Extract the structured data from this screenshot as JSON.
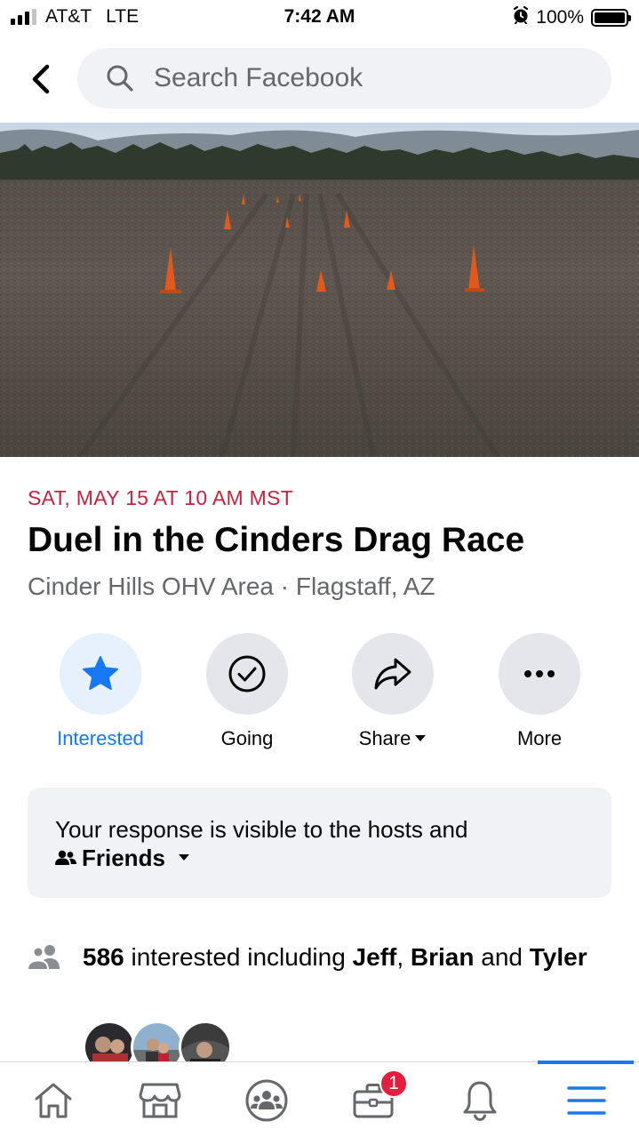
{
  "status_bar": {
    "carrier": "AT&T",
    "network": "LTE",
    "time": "7:42 AM",
    "battery": "100%",
    "battery_level": 1.0
  },
  "header": {
    "back_icon": "chevron-left-icon",
    "search_placeholder": "Search Facebook"
  },
  "event": {
    "date": "SAT, MAY 15 AT 10 AM MST",
    "title": "Duel in the Cinders Drag Race",
    "location": "Cinder Hills OHV Area · Flagstaff, AZ"
  },
  "actions": [
    {
      "label": "Interested",
      "icon": "star-icon",
      "active": true
    },
    {
      "label": "Going",
      "icon": "check-circle-icon",
      "active": false
    },
    {
      "label": "Share",
      "icon": "share-arrow-icon",
      "active": false
    },
    {
      "label": "More",
      "icon": "more-dots-icon",
      "active": false
    }
  ],
  "response": {
    "text": "Your response is visible to the hosts and",
    "audience": "Friends"
  },
  "interested": {
    "count": "586",
    "text": " interested including ",
    "name1": "Jeff",
    "sep1": ", ",
    "name2": "Brian",
    "sep2": " and ",
    "name3": "Tyler"
  },
  "tabbar": {
    "tabs": [
      "home-icon",
      "marketplace-icon",
      "groups-icon",
      "jobs-icon",
      "notifications-icon",
      "menu-icon"
    ],
    "jobs_badge": "1",
    "active_tab": "menu-icon"
  },
  "colors": {
    "accent": "#1877f2",
    "date_red": "#c3253f",
    "badge_red": "#e41e3f",
    "secondary_text": "#65676b",
    "chip_bg": "#e4e6eb"
  }
}
